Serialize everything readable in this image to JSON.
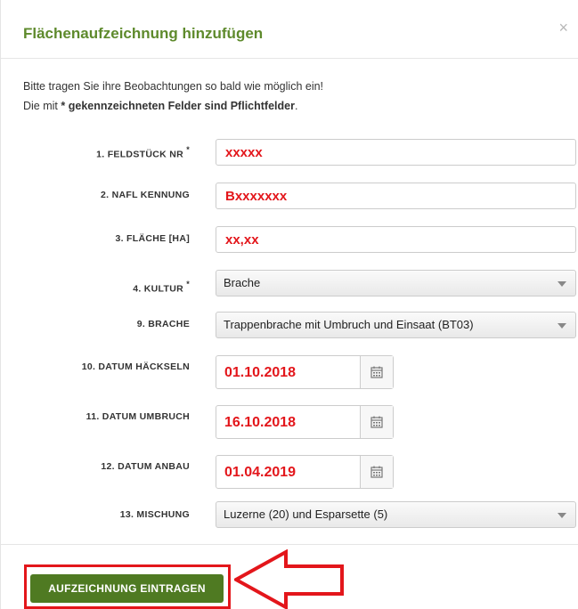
{
  "modal": {
    "title": "Flächenaufzeichnung hinzufügen",
    "close_glyph": "×"
  },
  "intro": {
    "line1": "Bitte tragen Sie ihre Beobachtungen so bald wie möglich ein!",
    "line2_prefix": "Die mit",
    "line2_bold": "* gekennzeichneten Felder sind Pflichtfelder",
    "line2_suffix": "."
  },
  "fields": {
    "feldstueck": {
      "label": "1. Feldstück Nr",
      "required": "*",
      "value": "xxxxx"
    },
    "nafl": {
      "label": "2. NAFL Kennung",
      "value": "Bxxxxxxx"
    },
    "flaeche": {
      "label": "3. Fläche [ha]",
      "value": "xx,xx"
    },
    "kultur": {
      "label": "4. Kultur",
      "required": "*",
      "value": "Brache"
    },
    "brache": {
      "label": "9. Brache",
      "value": "Trappenbrache mit Umbruch und Einsaat (BT03)"
    },
    "haeckseln": {
      "label": "10. Datum Häckseln",
      "value": "01.10.2018"
    },
    "umbruch": {
      "label": "11. Datum Umbruch",
      "value": "16.10.2018"
    },
    "anbau": {
      "label": "12. Datum Anbau",
      "value": "01.04.2019"
    },
    "mischung": {
      "label": "13. Mischung",
      "value": "Luzerne (20) und Esparsette (5)"
    }
  },
  "footer": {
    "submit_label": "Aufzeichnung eintragen"
  },
  "colors": {
    "title": "#5e8a2c",
    "button": "#4f7a22",
    "annotation": "#e3161b"
  }
}
